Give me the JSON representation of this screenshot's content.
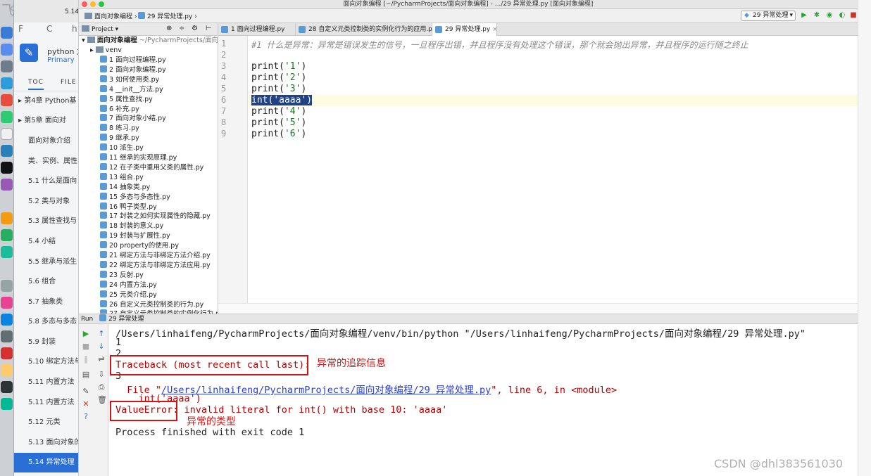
{
  "window_title": "面向对象编程 [~/PycharmProjects/面向对象编程] - .../29 异常处理.py [面向对象编程]",
  "watermark_ghost": "飞 学 城",
  "toc_panel": {
    "header_text": "5.14",
    "ui_fragments": {
      "f1": "F",
      "f2": "C",
      "f3": "h"
    },
    "book_title": "python 之",
    "book_subtitle": "Primary",
    "tabs": [
      "TOC",
      "FILE"
    ],
    "items": [
      {
        "label": "第4章 Python基",
        "arrow": true
      },
      {
        "label": "第5章 面向对",
        "arrow": true
      },
      {
        "label": "面向对象介绍"
      },
      {
        "label": "类、实例、属性"
      },
      {
        "label": "5.1 什么是面向"
      },
      {
        "label": "5.2 类与对象"
      },
      {
        "label": "5.3 属性查找与"
      },
      {
        "label": "5.4 小结"
      },
      {
        "label": "5.5 继承与派生"
      },
      {
        "label": "5.6 组合"
      },
      {
        "label": "5.7 抽象类"
      },
      {
        "label": "5.8 多态与多态"
      },
      {
        "label": "5.9 封装"
      },
      {
        "label": "5.10 绑定方法与"
      },
      {
        "label": "5.11 内置方法"
      },
      {
        "label": "5.11 内置方法"
      },
      {
        "label": "5.12 元类"
      },
      {
        "label": "5.13 面向对象的"
      },
      {
        "label": "5.14 异常处理",
        "selected": true
      }
    ]
  },
  "navbar": {
    "crumb_project": "面向对象编程",
    "crumb_file": "29 异常处理.py",
    "run_config": "29 异常处理"
  },
  "project_panel": {
    "title": "Project",
    "root": "面向对象编程",
    "root_path": "~/PycharmProjects/面向",
    "venv": "venv",
    "files": [
      "1 面向过程编程.py",
      "2 面向对象编程.py",
      "3 如何使用类.py",
      "4 __init__方法.py",
      "5 属性查找.py",
      "6 补充.py",
      "7 面向对象小结.py",
      "8 练习.py",
      "9 继承.py",
      "10 派生.py",
      "11 继承的实现原理.py",
      "12 在子类中重用父类的属性.py",
      "13 组合.py",
      "14 抽象类.py",
      "15 多态与多态性.py",
      "16 鸭子类型.py",
      "17 封装之如何实现属性的隐藏.py",
      "18 封装的意义.py",
      "19 封装与扩展性.py",
      "20 property的使用.py",
      "21 绑定方法与非绑定方法介绍.py",
      "22 绑定方法与非绑定方法应用.py",
      "23 反射.py",
      "24 内置方法.py",
      "25 元类介绍.py",
      "26 自定义元类控制类的行为.py",
      "27 自定义元类控制类的实例化行为.p"
    ]
  },
  "editor_tabs": [
    {
      "label": "1 面向过程编程.py",
      "active": false
    },
    {
      "label": "28 自定义元类控制类的实例化行为的应用.py",
      "active": false
    },
    {
      "label": "29 异常处理.py",
      "active": true
    }
  ],
  "code_lines": [
    {
      "num": "1",
      "text": "#1 什么是异常：异常是错误发生的信号，一旦程序出错，并且程序没有处理这个错误，那个就会抛出异常，并且程序的运行随之终止"
    },
    {
      "num": "2",
      "text": ""
    },
    {
      "num": "3",
      "fn": "print(",
      "str": "'1'",
      "end": ")"
    },
    {
      "num": "4",
      "fn": "print(",
      "str": "'2'",
      "end": ")"
    },
    {
      "num": "5",
      "fn": "print(",
      "str": "'3'",
      "end": ")"
    },
    {
      "num": "6",
      "fn": "int(",
      "str": "'aaaa'",
      "end": ")"
    },
    {
      "num": "7",
      "fn": "print(",
      "str": "'4'",
      "end": ")"
    },
    {
      "num": "8",
      "fn": "print(",
      "str": "'5'",
      "end": ")"
    },
    {
      "num": "9",
      "fn": "print(",
      "str": "'6'",
      "end": ")"
    }
  ],
  "run_panel": {
    "run_label": "Run",
    "tab_label": "29 异常处理",
    "console": {
      "cmd": "/Users/linhaifeng/PycharmProjects/面向对象编程/venv/bin/python \"/Users/linhaifeng/PycharmProjects/面向对象编程/29 异常处理.py\"",
      "out1": "1",
      "out2": "2",
      "traceback": "Traceback (most recent call last):",
      "out3": "3",
      "file_prefix": "  File \"",
      "file_link": "/Users/linhaifeng/PycharmProjects/面向对象编程/29 异常处理.py",
      "file_suffix": "\", line 6, in <module>",
      "code_line": "    int('aaaa')",
      "error_type": "ValueError",
      "error_msg": ": invalid literal for int() with base 10: 'aaaa'",
      "process": "Process finished with exit code 1"
    }
  },
  "annotations": {
    "traceback_note": "异常的追踪信息",
    "type_note": "异常的类型"
  },
  "watermark": "CSDN @dhl383561030",
  "colors": {
    "accent": "#2a6fd6",
    "annotation": "#d21414",
    "selection": "#214283"
  }
}
